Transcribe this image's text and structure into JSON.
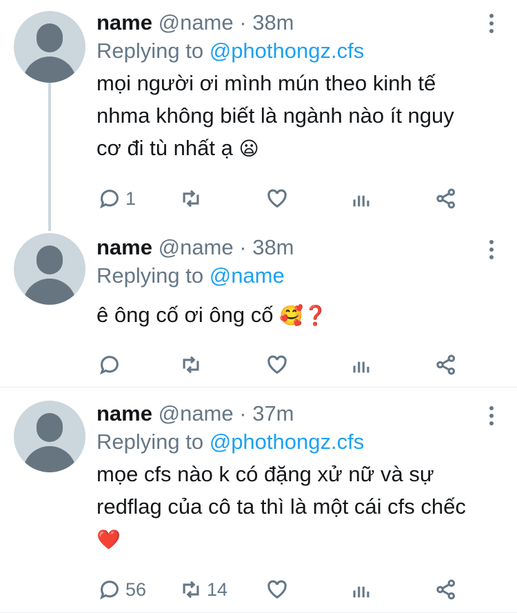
{
  "tweets": [
    {
      "name": "name",
      "handle": "@name",
      "separator": "·",
      "time": "38m",
      "replying_prefix": "Replying to",
      "replying_to": "@phothongz.cfs",
      "text": "mọi người ơi mình mún theo kinh tế nhma không biết là ngành nào ít nguy cơ đi tù nhất ạ",
      "emoji": "😦",
      "reply_count": "1",
      "retweet_count": "",
      "like_count": ""
    },
    {
      "name": "name",
      "handle": "@name",
      "separator": "·",
      "time": "38m",
      "replying_prefix": "Replying to",
      "replying_to": "@name",
      "text": "ê ông cố ơi ông cố",
      "emoji": "🥰❓",
      "reply_count": "",
      "retweet_count": "",
      "like_count": ""
    },
    {
      "name": "name",
      "handle": "@name",
      "separator": "·",
      "time": "37m",
      "replying_prefix": "Replying to",
      "replying_to": "@phothongz.cfs",
      "text": "mọe cfs nào k có đặng xử nữ và sự redflag của cô ta thì là một cái cfs chếc",
      "emoji": "❤️",
      "reply_count": "56",
      "retweet_count": "14",
      "like_count": ""
    }
  ],
  "icons": {
    "reply": "speech-bubble-icon",
    "retweet": "retweet-icon",
    "like": "heart-icon",
    "stats": "bar-chart-icon",
    "share": "share-icon",
    "menu": "vertical-dots-icon"
  },
  "colors": {
    "mention": "#1da1f2",
    "muted": "#657786",
    "avatar_bg": "#ccd6dd",
    "avatar_fg": "#66757f"
  }
}
